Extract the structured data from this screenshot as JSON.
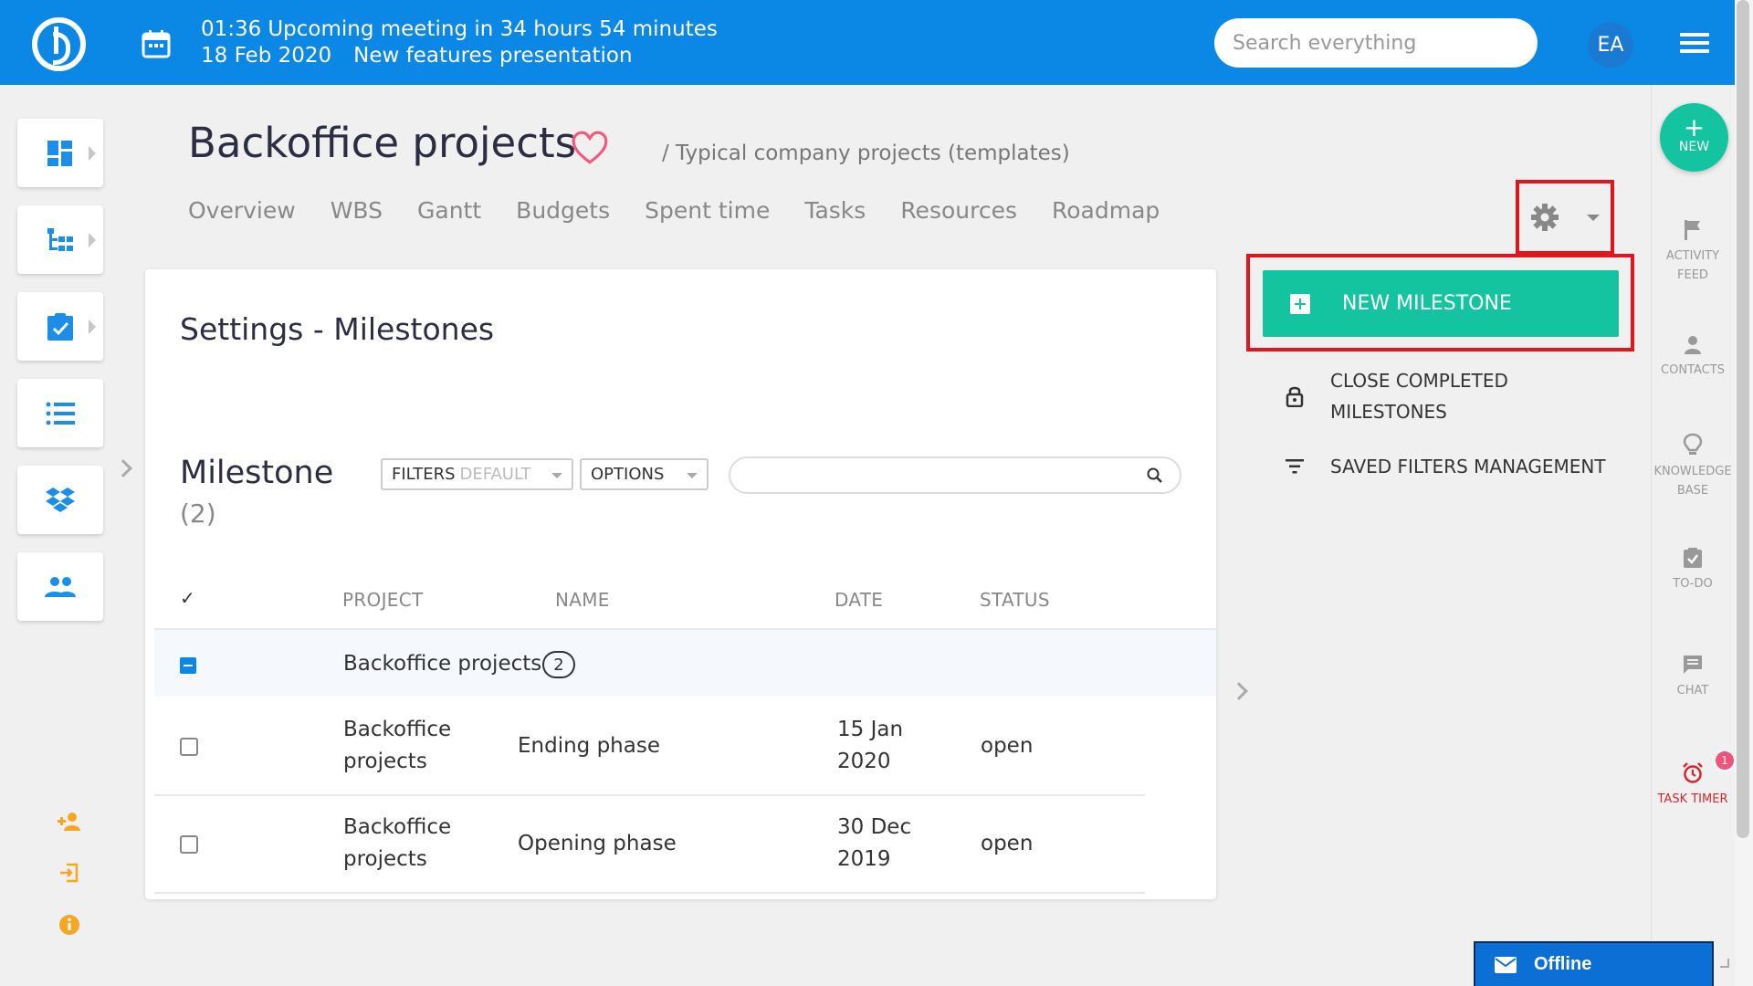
{
  "topbar": {
    "meeting_time": "01:36",
    "meeting_text": "Upcoming meeting in 34 hours 54 minutes",
    "meeting_date": "18 Feb 2020",
    "meeting_name": "New features presentation",
    "search_placeholder": "Search everything",
    "avatar_initials": "EA",
    "color": "#0b87e6"
  },
  "project": {
    "title": "Backoffice projects",
    "breadcrumb": "/ Typical company projects (templates)",
    "tabs": [
      "Overview",
      "WBS",
      "Gantt",
      "Budgets",
      "Spent time",
      "Tasks",
      "Resources",
      "Roadmap"
    ]
  },
  "card": {
    "title": "Settings - Milestones",
    "list_label": "Milestone",
    "list_count": "(2)",
    "filters_label": "FILTERS",
    "filters_value": "DEFAULT",
    "options_label": "OPTIONS",
    "search_value": "",
    "check_header": "✓",
    "columns": [
      "PROJECT",
      "NAME",
      "DATE",
      "STATUS"
    ],
    "group": {
      "name": "Backoffice projects",
      "count": "2"
    },
    "rows": [
      {
        "project_l1": "Backoffice",
        "project_l2": "projects",
        "name": "Ending phase",
        "date_l1": "15 Jan",
        "date_l2": "2020",
        "status": "open"
      },
      {
        "project_l1": "Backoffice",
        "project_l2": "projects",
        "name": "Opening phase",
        "date_l1": "30 Dec",
        "date_l2": "2019",
        "status": "open"
      }
    ]
  },
  "actions": {
    "new_milestone": "NEW MILESTONE",
    "close_completed_l1": "CLOSE COMPLETED",
    "close_completed_l2": "MILESTONES",
    "saved_filters": "SAVED FILTERS MANAGEMENT",
    "accent": "#14c4a0",
    "highlight": "#e0151e"
  },
  "rail": {
    "new_label": "NEW",
    "activity_l1": "ACTIVITY",
    "activity_l2": "FEED",
    "contacts": "CONTACTS",
    "knowledge_l1": "KNOWLEDGE",
    "knowledge_l2": "BASE",
    "todo": "TO-DO",
    "chat": "CHAT",
    "task_timer": "TASK TIMER",
    "timer_badge": "1"
  },
  "offline": {
    "label": "Offline"
  }
}
